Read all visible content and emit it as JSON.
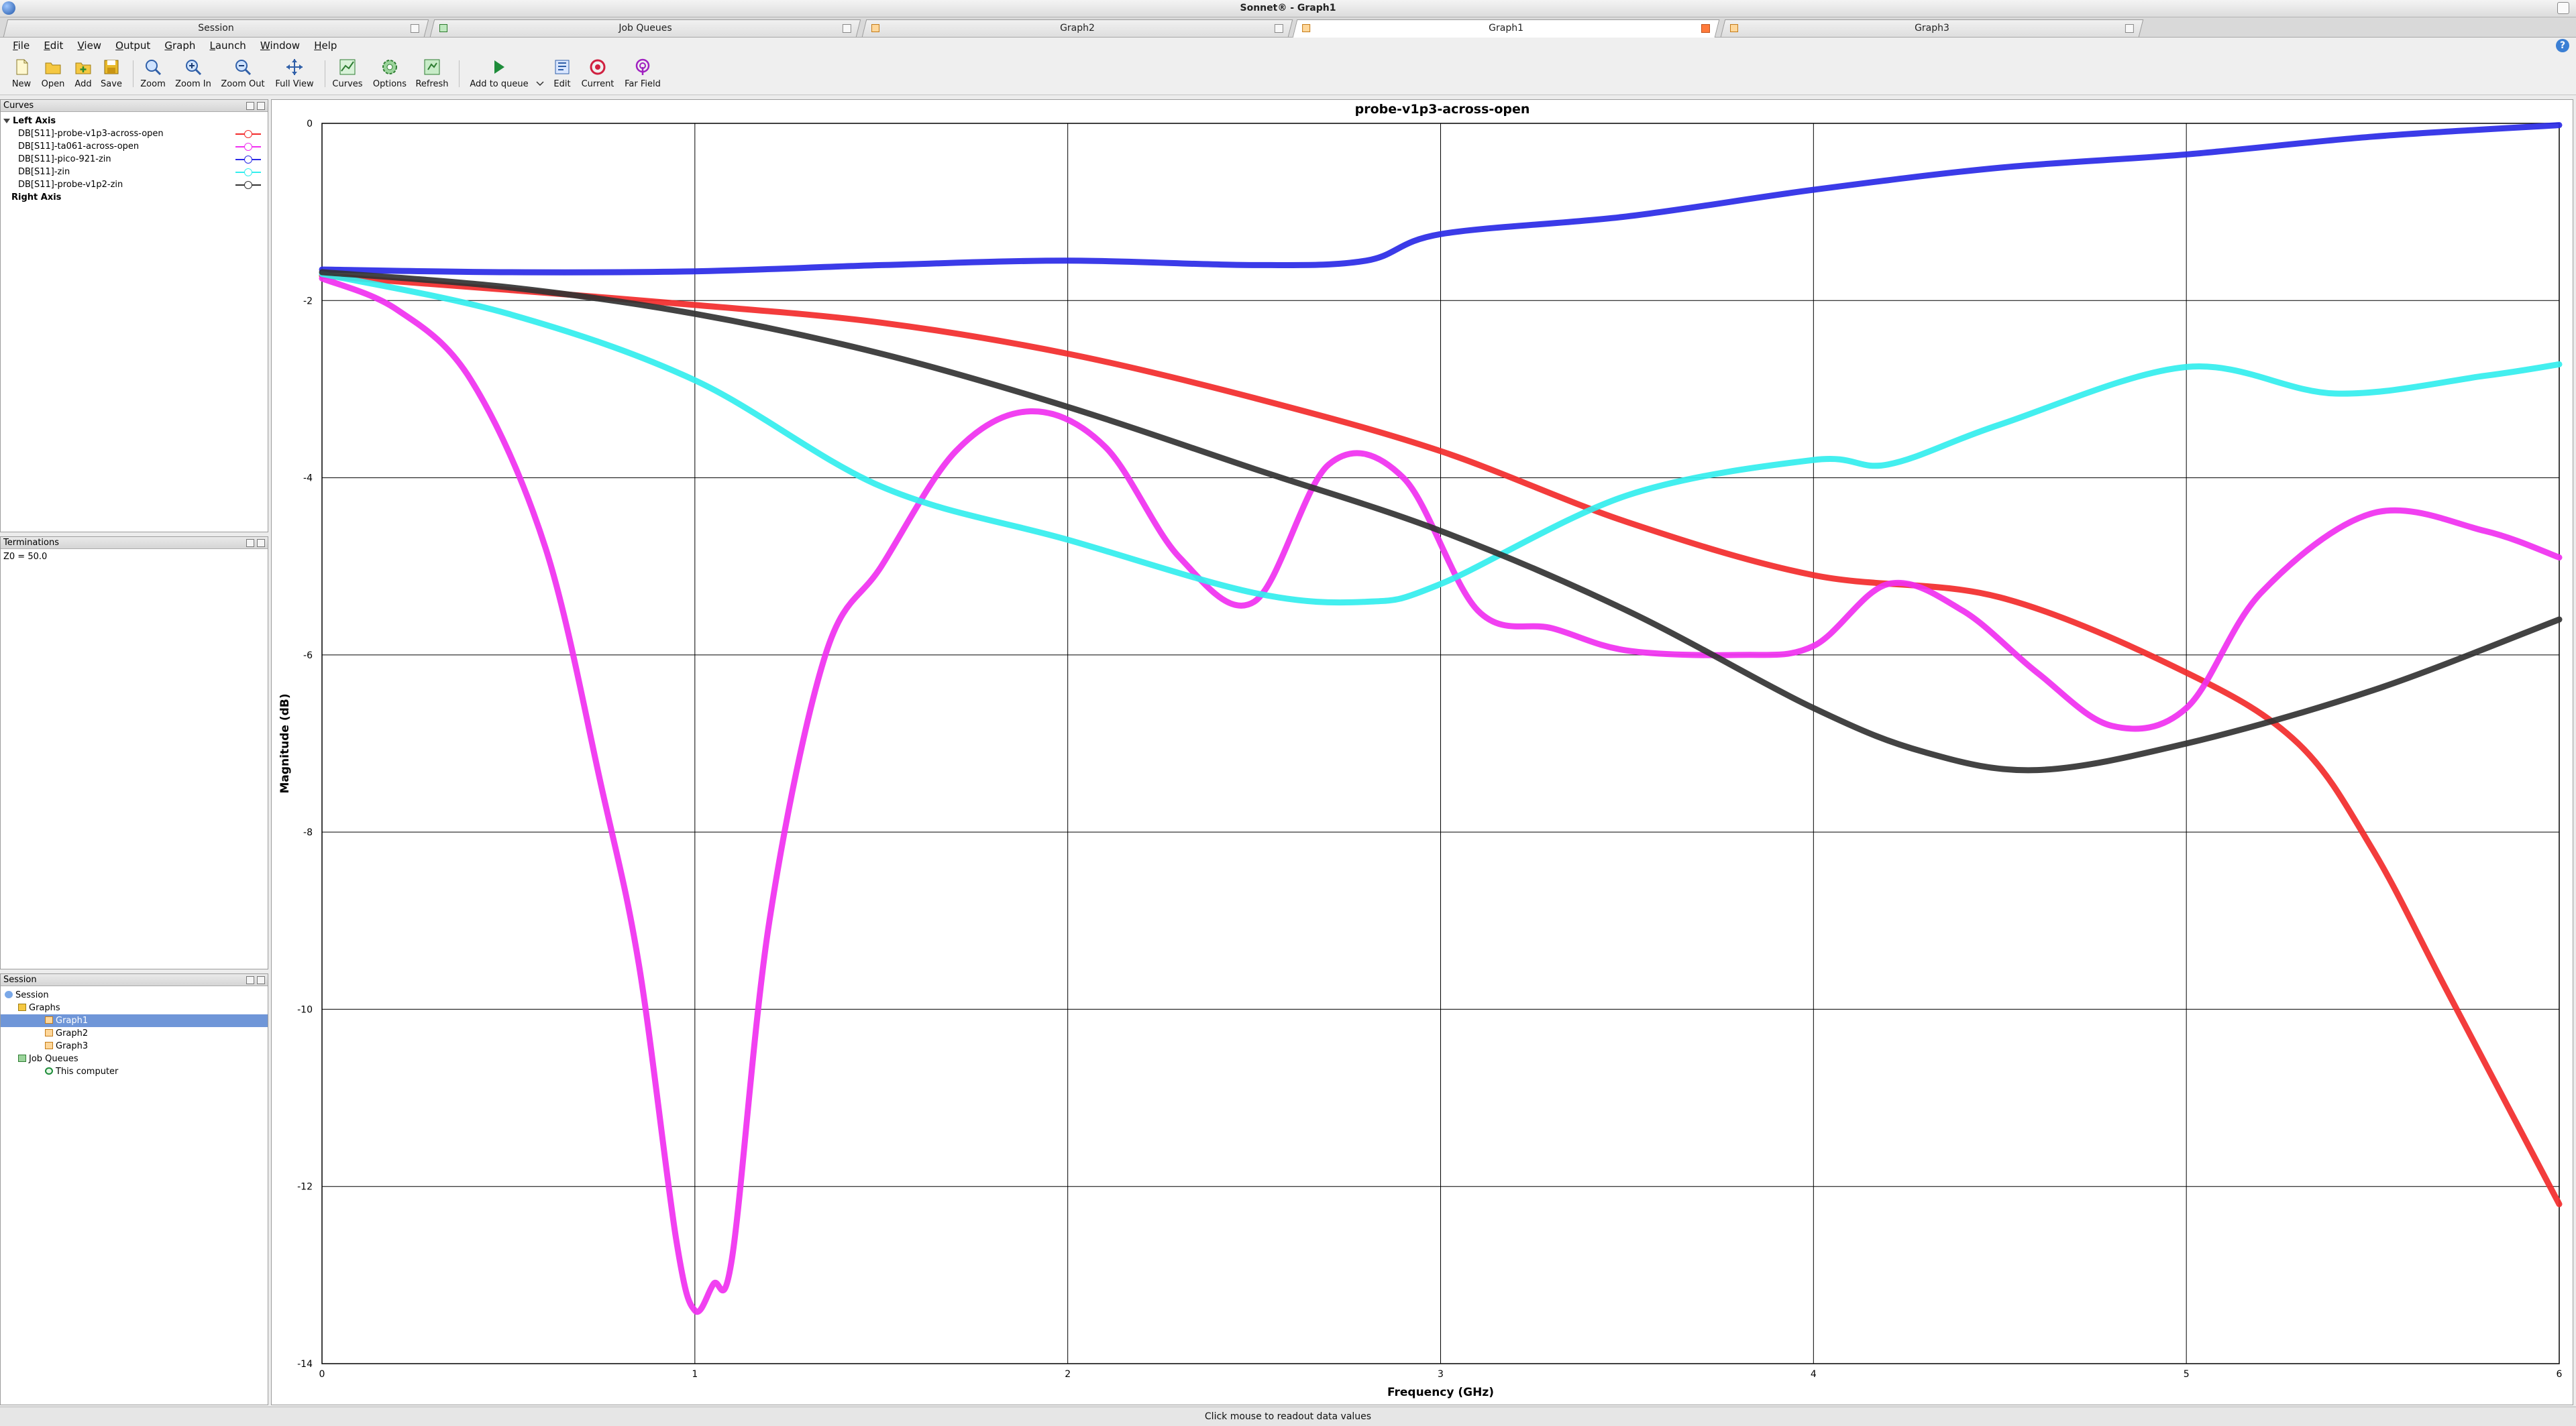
{
  "window": {
    "title": "Sonnet® - Graph1"
  },
  "tabs": [
    {
      "label": "Session",
      "active": false
    },
    {
      "label": "Job Queues",
      "active": false
    },
    {
      "label": "Graph2",
      "active": false
    },
    {
      "label": "Graph1",
      "active": true
    },
    {
      "label": "Graph3",
      "active": false
    }
  ],
  "menu": [
    "File",
    "Edit",
    "View",
    "Output",
    "Graph",
    "Launch",
    "Window",
    "Help"
  ],
  "toolbar": {
    "new": "New",
    "open": "Open",
    "add": "Add",
    "save": "Save",
    "zoom": "Zoom",
    "zoom_in": "Zoom In",
    "zoom_out": "Zoom Out",
    "full_view": "Full View",
    "curves": "Curves",
    "options": "Options",
    "refresh": "Refresh",
    "add_to_queue": "Add to queue",
    "edit": "Edit",
    "current": "Current",
    "far_field": "Far Field"
  },
  "curves_panel": {
    "title": "Curves",
    "left_axis": "Left Axis",
    "right_axis": "Right Axis",
    "items": [
      {
        "label": "DB[S11]-probe-v1p3-across-open",
        "color": "#f22b2b"
      },
      {
        "label": "DB[S11]-ta061-across-open",
        "color": "#f030f0"
      },
      {
        "label": "DB[S11]-pico-921-zin",
        "color": "#2a2ae6"
      },
      {
        "label": "DB[S11]-zin",
        "color": "#33eeee"
      },
      {
        "label": "DB[S11]-probe-v1p2-zin",
        "color": "#333333"
      }
    ]
  },
  "terminations_panel": {
    "title": "Terminations",
    "z0": "Z0 = 50.0"
  },
  "session_panel": {
    "title": "Session",
    "root": "Session",
    "graphs": "Graphs",
    "graph_items": [
      "Graph1",
      "Graph2",
      "Graph3"
    ],
    "job_queues": "Job Queues",
    "this_computer": "This computer"
  },
  "status": "Click mouse to readout data values",
  "chart_data": {
    "type": "line",
    "title": "probe-v1p3-across-open",
    "xlabel": "Frequency (GHz)",
    "ylabel": "Magnitude (dB)",
    "xlim": [
      0,
      6
    ],
    "ylim": [
      -14,
      0
    ],
    "xticks": [
      0,
      1,
      2,
      3,
      4,
      5,
      6
    ],
    "yticks": [
      0,
      -2,
      -4,
      -6,
      -8,
      -10,
      -12,
      -14
    ],
    "grid": true,
    "series": [
      {
        "name": "DB[S11]-probe-v1p3-across-open",
        "color": "#f22b2b",
        "x": [
          0,
          0.5,
          1,
          1.5,
          2,
          2.5,
          3,
          3.5,
          4,
          4.5,
          5,
          5.3,
          5.5,
          5.7,
          6
        ],
        "y": [
          -1.72,
          -1.88,
          -2.05,
          -2.25,
          -2.6,
          -3.1,
          -3.7,
          -4.5,
          -5.1,
          -5.35,
          -6.2,
          -7.0,
          -8.2,
          -9.8,
          -12.2
        ]
      },
      {
        "name": "DB[S11]-ta061-across-open",
        "color": "#f030f0",
        "x": [
          0,
          0.2,
          0.4,
          0.6,
          0.75,
          0.85,
          0.95,
          1.0,
          1.05,
          1.1,
          1.2,
          1.35,
          1.5,
          1.7,
          1.9,
          2.1,
          2.3,
          2.5,
          2.7,
          2.9,
          3.1,
          3.3,
          3.5,
          3.8,
          4.0,
          4.2,
          4.4,
          4.6,
          4.8,
          5.0,
          5.2,
          5.5,
          5.8,
          6.0
        ],
        "y": [
          -1.75,
          -2.1,
          -2.9,
          -4.8,
          -7.5,
          -9.5,
          -12.6,
          -13.4,
          -13.1,
          -12.8,
          -9.0,
          -6.0,
          -5.0,
          -3.7,
          -3.25,
          -3.65,
          -4.9,
          -5.4,
          -3.85,
          -4.0,
          -5.5,
          -5.7,
          -5.95,
          -6.0,
          -5.9,
          -5.2,
          -5.5,
          -6.2,
          -6.8,
          -6.6,
          -5.3,
          -4.4,
          -4.6,
          -4.9
        ]
      },
      {
        "name": "DB[S11]-pico-921-zin",
        "color": "#2a2ae6",
        "x": [
          0,
          0.5,
          1,
          1.5,
          2,
          2.5,
          2.8,
          3.0,
          3.5,
          4.0,
          4.5,
          5.0,
          5.5,
          6.0
        ],
        "y": [
          -1.65,
          -1.68,
          -1.67,
          -1.6,
          -1.55,
          -1.6,
          -1.55,
          -1.25,
          -1.05,
          -0.75,
          -0.5,
          -0.35,
          -0.15,
          -0.02
        ]
      },
      {
        "name": "DB[S11]-zin",
        "color": "#33eeee",
        "x": [
          0,
          0.5,
          1,
          1.5,
          2,
          2.5,
          2.8,
          3.0,
          3.5,
          4.0,
          4.2,
          4.5,
          5.0,
          5.4,
          5.8,
          6.0
        ],
        "y": [
          -1.7,
          -2.15,
          -2.9,
          -4.1,
          -4.7,
          -5.3,
          -5.4,
          -5.2,
          -4.2,
          -3.8,
          -3.85,
          -3.4,
          -2.75,
          -3.05,
          -2.85,
          -2.72
        ]
      },
      {
        "name": "DB[S11]-probe-v1p2-zin",
        "color": "#333333",
        "x": [
          0,
          0.5,
          1,
          1.5,
          2,
          2.5,
          3,
          3.5,
          4,
          4.3,
          4.6,
          5.0,
          5.5,
          6.0
        ],
        "y": [
          -1.68,
          -1.85,
          -2.15,
          -2.6,
          -3.2,
          -3.9,
          -4.6,
          -5.5,
          -6.6,
          -7.1,
          -7.3,
          -7.0,
          -6.4,
          -5.6
        ]
      }
    ]
  }
}
